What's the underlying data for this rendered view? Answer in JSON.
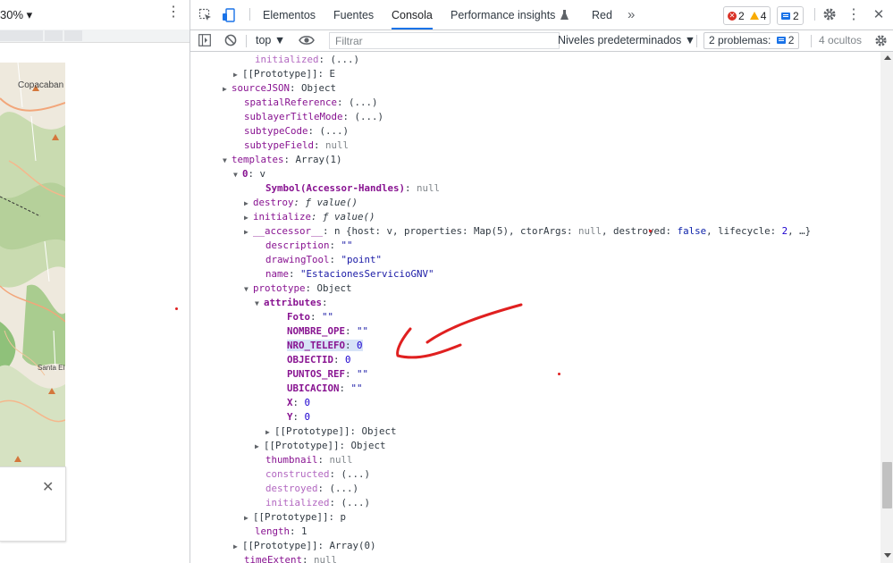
{
  "browser": {
    "zoom_label": "30% ▾",
    "more_icon": "⋮",
    "map_labels": [
      "Copacaban",
      "Santa El"
    ],
    "popup_close": "✕"
  },
  "devtools": {
    "tabs": [
      "Elementos",
      "Fuentes",
      "Consola",
      "Performance insights",
      "Red"
    ],
    "active_tab": "Consola",
    "perf_icon": "flask-icon",
    "more_tabs": "»",
    "error_count": "2",
    "warning_count": "4",
    "message_count": "2",
    "settings_icon": "gear-icon",
    "menu_icon": "⋮",
    "close_icon": "✕"
  },
  "toolbar": {
    "context": "top ▼",
    "filter_placeholder": "Filtrar",
    "levels": "Niveles predeterminados ▼",
    "problems_label": "2 problemas:",
    "problems_count": "2",
    "hidden": "4 ocultos"
  },
  "console_rows": [
    {
      "t": "initialized",
      "s": ": (...)"
    },
    {
      "t": "[[Prototype]]",
      "s": ": E"
    },
    {
      "t": "sourceJSON",
      "s": ": Object"
    },
    {
      "t": "spatialReference",
      "s": ": (...)"
    },
    {
      "t": "sublayerTitleMode",
      "s": ": (...)"
    },
    {
      "t": "subtypeCode",
      "s": ": (...)"
    },
    {
      "t": "subtypeField",
      "s": ": ",
      "v": "null"
    },
    {
      "t": "templates",
      "s": ": Array(1)"
    },
    {
      "t": "0",
      "s": ": v"
    },
    {
      "t": "Symbol(Accessor-Handles)",
      "s": ": ",
      "v": "null"
    },
    {
      "t": "destroy",
      "s": ": ƒ value()"
    },
    {
      "t": "initialize",
      "s": ": ƒ value()"
    },
    {
      "t": "__accessor__",
      "s": ": n {host: v, properties: Map(5), ctorArgs: ",
      "v": "null",
      "s2": ", destroyed: ",
      "b": "false",
      "s3": ", lifecycle: ",
      "n": "2",
      "s4": ", …}"
    },
    {
      "t": "description",
      "s": ": ",
      "v": "\"\""
    },
    {
      "t": "drawingTool",
      "s": ": ",
      "v": "\"point\""
    },
    {
      "t": "name",
      "s": ": ",
      "v": "\"EstacionesServicioGNV\""
    },
    {
      "t": "prototype",
      "s": ": Object"
    },
    {
      "t": "attributes",
      "s": ":"
    },
    {
      "t": "Foto",
      "s": ": ",
      "v": "\"\""
    },
    {
      "t": "NOMBRE_OPE",
      "s": ": ",
      "v": "\"\""
    },
    {
      "t": "NRO_TELEFO",
      "s": ": ",
      "v": "0"
    },
    {
      "t": "OBJECTID",
      "s": ": ",
      "v": "0"
    },
    {
      "t": "PUNTOS_REF",
      "s": ": ",
      "v": "\"\""
    },
    {
      "t": "UBICACION",
      "s": ": ",
      "v": "\"\""
    },
    {
      "t": "X",
      "s": ": ",
      "v": "0"
    },
    {
      "t": "Y",
      "s": ": ",
      "v": "0"
    },
    {
      "t": "[[Prototype]]",
      "s": ": Object"
    },
    {
      "t": "[[Prototype]]",
      "s": ": Object"
    },
    {
      "t": "thumbnail",
      "s": ": ",
      "v": "null"
    },
    {
      "t": "constructed",
      "s": ": (...)"
    },
    {
      "t": "destroyed",
      "s": ": (...)"
    },
    {
      "t": "initialized",
      "s": ": (...)"
    },
    {
      "t": "[[Prototype]]",
      "s": ": p"
    },
    {
      "t": "length",
      "s": ": 1"
    },
    {
      "t": "[[Prototype]]",
      "s": ": Array(0)"
    },
    {
      "t": "timeExtent",
      "s": ": ",
      "v": "null"
    }
  ],
  "colors": {
    "accent": "#1a73e8",
    "error": "#d93025",
    "warning": "#f9ab00",
    "key_purple": "#881391",
    "string_blue": "#1a1aa6",
    "annotation_red": "#e02020"
  }
}
